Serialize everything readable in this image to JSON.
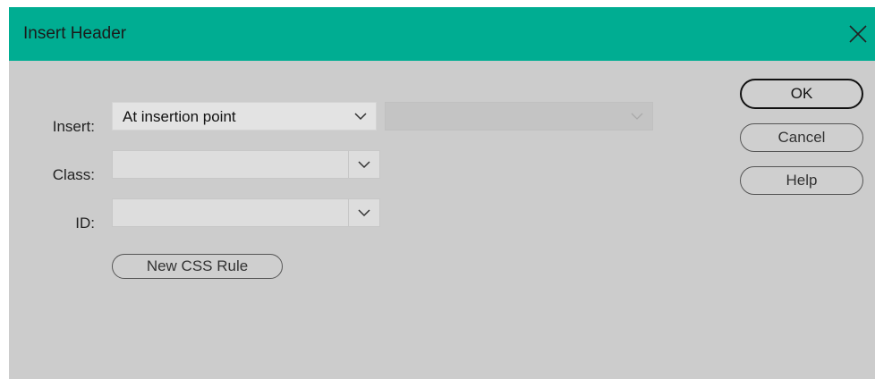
{
  "window": {
    "title": "Insert Header",
    "close_icon": "close-icon"
  },
  "form": {
    "insert": {
      "label": "Insert:",
      "value": "At insertion point",
      "secondary_value": ""
    },
    "class": {
      "label": "Class:",
      "value": ""
    },
    "id": {
      "label": "ID:",
      "value": ""
    },
    "new_css_rule_label": "New CSS Rule"
  },
  "buttons": {
    "ok": "OK",
    "cancel": "Cancel",
    "help": "Help"
  },
  "colors": {
    "titlebar": "#00ad92",
    "dialog_bg": "#cccccc"
  }
}
